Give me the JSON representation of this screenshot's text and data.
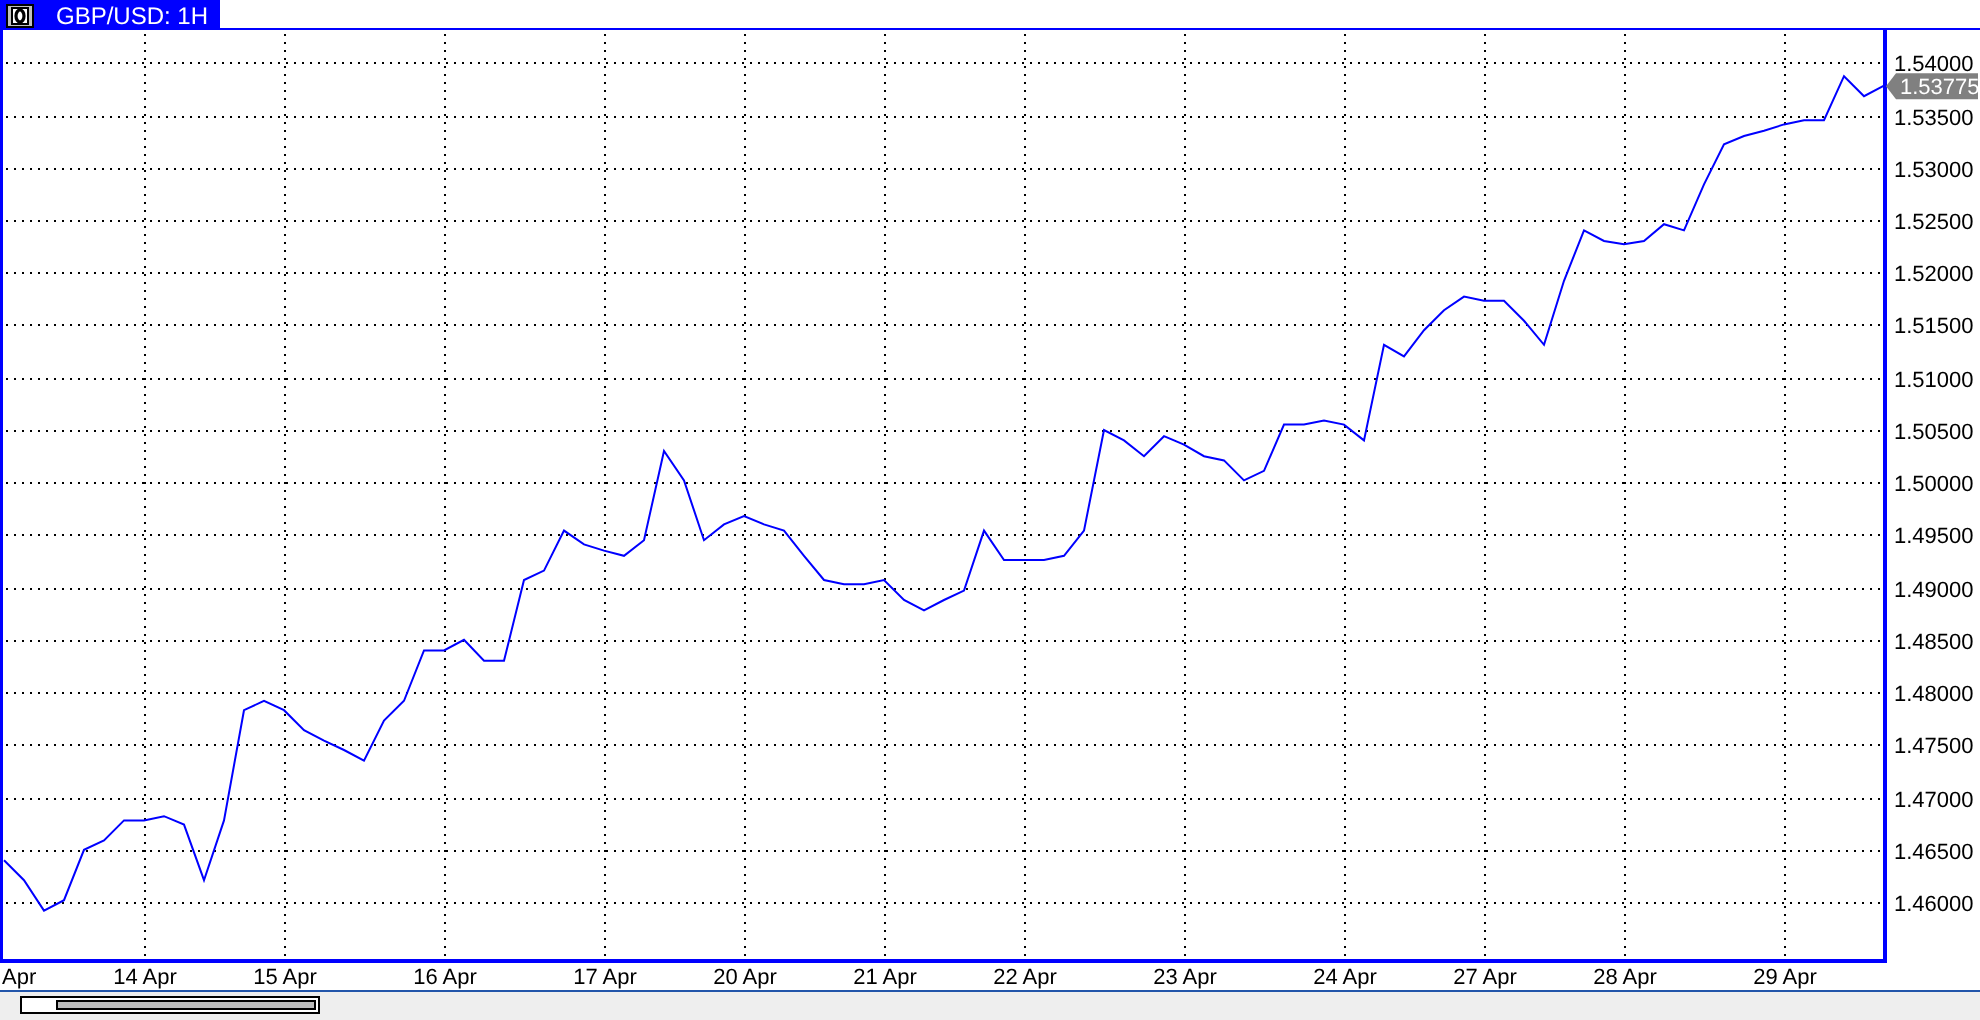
{
  "title_bar": {
    "tab_label": "GBP/USD: 1H",
    "selected": true
  },
  "chart": {
    "current_price": "1.53775",
    "chart_data": {
      "type": "line",
      "grid": true,
      "categories": [
        null,
        "Apr",
        null,
        null,
        null,
        null,
        null,
        "14 Apr",
        null,
        null,
        null,
        null,
        null,
        null,
        "15 Apr",
        null,
        null,
        null,
        null,
        null,
        null,
        null,
        "16 Apr",
        null,
        null,
        null,
        null,
        null,
        null,
        null,
        "17 Apr",
        null,
        null,
        null,
        null,
        null,
        null,
        "20 Apr",
        null,
        null,
        null,
        null,
        null,
        null,
        "21 Apr",
        null,
        null,
        null,
        null,
        null,
        null,
        "22 Apr",
        null,
        null,
        null,
        null,
        null,
        null,
        null,
        "23 Apr",
        null,
        null,
        null,
        null,
        null,
        null,
        null,
        "24 Apr",
        null,
        null,
        null,
        null,
        null,
        null,
        "27 Apr",
        null,
        null,
        null,
        null,
        null,
        null,
        "28 Apr",
        null,
        null,
        null,
        null,
        null,
        null,
        null,
        "29 Apr",
        null,
        null,
        null,
        null,
        null
      ],
      "ylim": [
        1.4545,
        1.5431
      ],
      "yticks": [
        {
          "value": 1.46,
          "label": "1.46000"
        },
        {
          "value": 1.465,
          "label": "1.46500"
        },
        {
          "value": 1.47,
          "label": "1.47000"
        },
        {
          "value": 1.475,
          "label": "1.47500"
        },
        {
          "value": 1.48,
          "label": "1.48000"
        },
        {
          "value": 1.485,
          "label": "1.48500"
        },
        {
          "value": 1.49,
          "label": "1.49000"
        },
        {
          "value": 1.495,
          "label": "1.49500"
        },
        {
          "value": 1.5,
          "label": "1.50000"
        },
        {
          "value": 1.505,
          "label": "1.50500"
        },
        {
          "value": 1.51,
          "label": "1.51000"
        },
        {
          "value": 1.515,
          "label": "1.51500"
        },
        {
          "value": 1.52,
          "label": "1.52000"
        },
        {
          "value": 1.525,
          "label": "1.52500"
        },
        {
          "value": 1.53,
          "label": "1.53000"
        },
        {
          "value": 1.535,
          "label": "1.53500"
        },
        {
          "value": 1.54,
          "label": "1.54000"
        }
      ],
      "series": [
        {
          "color": "#0000ff",
          "values": [
            1.464,
            1.4621,
            1.4592,
            1.4602,
            1.465,
            1.4659,
            1.4678,
            1.4678,
            1.4682,
            1.4674,
            1.4621,
            1.4678,
            1.4783,
            1.4792,
            1.4783,
            1.4764,
            1.4754,
            1.4745,
            1.4735,
            1.4773,
            1.4792,
            1.484,
            1.484,
            1.485,
            1.483,
            1.483,
            1.4907,
            1.4916,
            1.4954,
            1.4941,
            1.4935,
            1.493,
            1.4945,
            1.503,
            1.5002,
            1.4945,
            1.496,
            1.4968,
            1.496,
            1.4954,
            1.493,
            1.4907,
            1.4903,
            1.4903,
            1.4907,
            1.4888,
            1.4878,
            1.4888,
            1.4897,
            1.4954,
            1.4926,
            1.4926,
            1.4926,
            1.493,
            1.4954,
            1.505,
            1.504,
            1.5025,
            1.5044,
            1.5036,
            1.5025,
            1.5021,
            1.5002,
            1.5011,
            1.5055,
            1.5055,
            1.5059,
            1.5055,
            1.504,
            1.5131,
            1.512,
            1.5145,
            1.5164,
            1.5177,
            1.5173,
            1.5173,
            1.5154,
            1.5131,
            1.5192,
            1.524,
            1.523,
            1.5227,
            1.523,
            1.5246,
            1.524,
            1.5284,
            1.5322,
            1.533,
            1.5335,
            1.5341,
            1.5345,
            1.5345,
            1.5387,
            1.5368,
            1.5378
          ]
        }
      ]
    }
  }
}
